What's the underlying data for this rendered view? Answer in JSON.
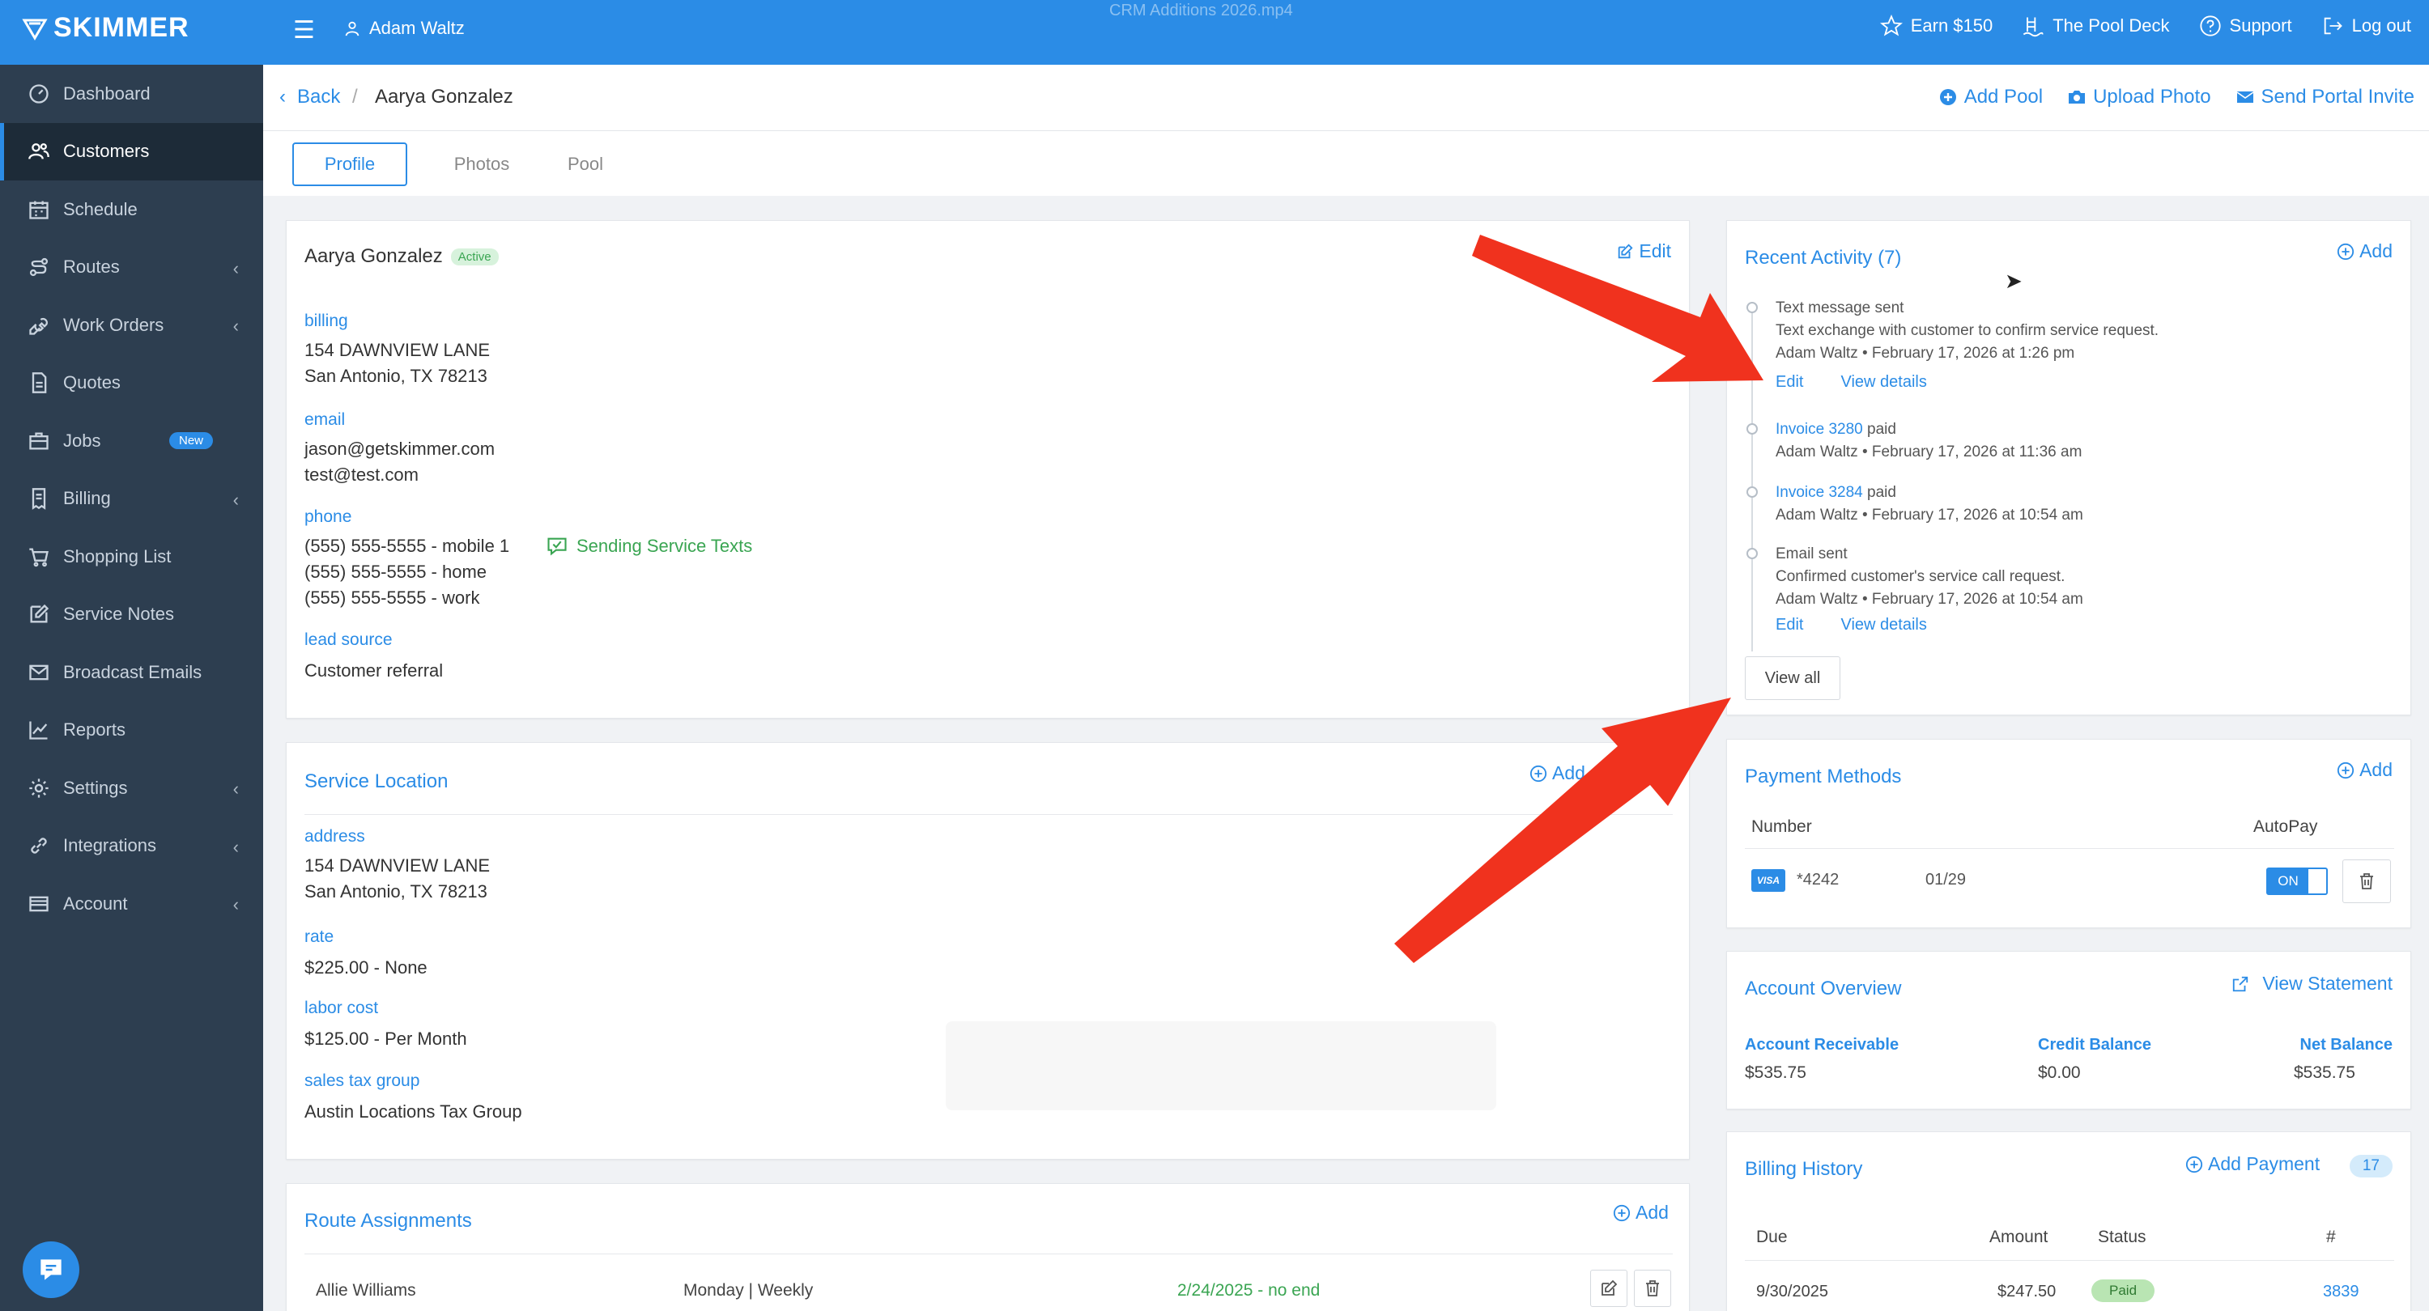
{
  "topbar": {
    "logo": "SKIMMER",
    "user": "Adam Waltz",
    "video_title": "CRM Additions 2026.mp4",
    "earn": "Earn $150",
    "pool_deck": "The Pool Deck",
    "support": "Support",
    "logout": "Log out"
  },
  "sidebar": {
    "items": [
      {
        "label": "Dashboard",
        "icon": "dashboard-icon"
      },
      {
        "label": "Customers",
        "icon": "customers-icon"
      },
      {
        "label": "Schedule",
        "icon": "calendar-icon"
      },
      {
        "label": "Routes",
        "icon": "routes-icon"
      },
      {
        "label": "Work Orders",
        "icon": "wrench-icon"
      },
      {
        "label": "Quotes",
        "icon": "quote-icon"
      },
      {
        "label": "Jobs",
        "icon": "briefcase-icon",
        "badge": "New"
      },
      {
        "label": "Billing",
        "icon": "billing-icon"
      },
      {
        "label": "Shopping List",
        "icon": "cart-icon"
      },
      {
        "label": "Service Notes",
        "icon": "edit-icon"
      },
      {
        "label": "Broadcast Emails",
        "icon": "mail-icon"
      },
      {
        "label": "Reports",
        "icon": "chart-icon"
      },
      {
        "label": "Settings",
        "icon": "gear-icon"
      },
      {
        "label": "Integrations",
        "icon": "link-icon"
      },
      {
        "label": "Account",
        "icon": "account-icon"
      }
    ]
  },
  "breadcrumb": {
    "back": "Back",
    "separator": "/",
    "current": "Aarya Gonzalez",
    "add_pool": "Add Pool",
    "upload_photo": "Upload Photo",
    "send_invite": "Send Portal Invite"
  },
  "tabs": [
    "Profile",
    "Photos",
    "Pool"
  ],
  "profile": {
    "name": "Aarya Gonzalez",
    "status": "Active",
    "edit": "Edit",
    "billing_label": "billing",
    "billing_line1": "154 DAWNVIEW LANE",
    "billing_line2": "San Antonio, TX 78213",
    "email_label": "email",
    "email1": "jason@getskimmer.com",
    "email2": "test@test.com",
    "phone_label": "phone",
    "phone1": "(555) 555-5555 - mobile 1",
    "phone2": "(555) 555-5555 - home",
    "phone3": "(555) 555-5555 - work",
    "sending_texts": "Sending Service Texts",
    "lead_label": "lead source",
    "lead_value": "Customer referral"
  },
  "service_location": {
    "title": "Service Location",
    "add": "Add",
    "address_label": "address",
    "address1": "154 DAWNVIEW LANE",
    "address2": "San Antonio, TX 78213",
    "rate_label": "rate",
    "rate_value": "$225.00 - None",
    "labor_label": "labor cost",
    "labor_value": "$125.00 - Per Month",
    "tax_label": "sales tax group",
    "tax_value": "Austin Locations Tax Group"
  },
  "route_assignments": {
    "title": "Route Assignments",
    "add": "Add",
    "tech": "Allie Williams",
    "schedule": "Monday | Weekly",
    "dates": "2/24/2025 - no end"
  },
  "recent_activity": {
    "title": "Recent Activity (7)",
    "add": "Add",
    "items": [
      {
        "line1": "Text message sent",
        "line2": "Text exchange with customer to confirm service request.",
        "meta": "Adam Waltz • February 17, 2026 at 1:26 pm"
      },
      {
        "link": "Invoice 3280",
        "suffix": " paid",
        "meta": "Adam Waltz • February 17, 2026 at 11:36 am"
      },
      {
        "link": "Invoice 3284",
        "suffix": " paid",
        "meta": "Adam Waltz • February 17, 2026 at 10:54 am"
      },
      {
        "line1": "Email sent",
        "line2": "Confirmed customer's service call request.",
        "meta": "Adam Waltz • February 17, 2026 at 10:54 am"
      }
    ],
    "edit": "Edit",
    "view_details": "View details",
    "view_all": "View all"
  },
  "payment_methods": {
    "title": "Payment Methods",
    "add": "Add",
    "col_number": "Number",
    "col_autopay": "AutoPay",
    "card_brand": "VISA",
    "card_number": "*4242",
    "expiry": "01/29",
    "autopay": "ON"
  },
  "account_overview": {
    "title": "Account Overview",
    "view_statement": "View Statement",
    "receivable_label": "Account Receivable",
    "receivable_value": "$535.75",
    "credit_label": "Credit Balance",
    "credit_value": "$0.00",
    "net_label": "Net Balance",
    "net_value": "$535.75"
  },
  "billing_history": {
    "title": "Billing History",
    "add_payment": "Add Payment",
    "count": "17",
    "col_due": "Due",
    "col_amount": "Amount",
    "col_status": "Status",
    "col_num": "#",
    "row_due": "9/30/2025",
    "row_amount": "$247.50",
    "row_status": "Paid",
    "row_num": "3839"
  },
  "colors": {
    "brand_blue": "#2b8ce6",
    "sidebar": "#2d3e50",
    "success_green": "#3aa552",
    "annotation_red": "#f0321e"
  }
}
